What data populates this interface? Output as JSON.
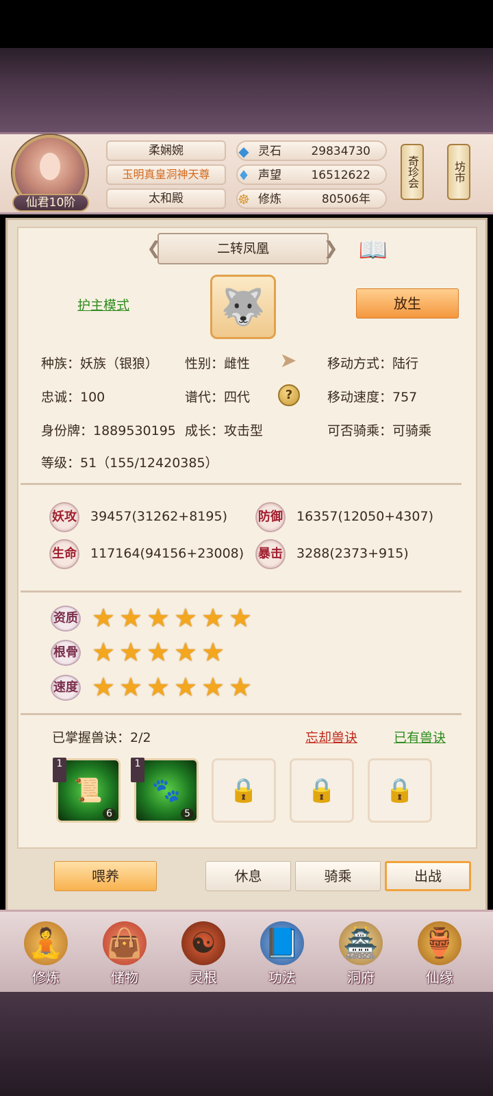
{
  "header": {
    "player_name": "柔娴婉",
    "title": "玉明真皇洞神天尊",
    "sect": "太和殿",
    "rank": "仙君10阶",
    "resources": [
      {
        "icon": "spirit-stone-icon",
        "label": "灵石",
        "value": "29834730"
      },
      {
        "icon": "reputation-icon",
        "label": "声望",
        "value": "16512622"
      },
      {
        "icon": "cultivation-icon",
        "label": "修炼",
        "value": "80506年"
      }
    ],
    "side_buttons": [
      "奇珍会",
      "坊市"
    ]
  },
  "pet": {
    "name": "二转凤凰",
    "mode_link": "护主模式",
    "release_label": "放生",
    "info": {
      "race": "种族：妖族（银狼）",
      "gender": "性别：雌性",
      "move_type": "移动方式：陆行",
      "loyalty": "忠诚：100",
      "generation": "谱代：四代",
      "move_speed": "移动速度：757",
      "id_tag": "身份牌：1889530195",
      "growth": "成长：攻击型",
      "rideable": "可否骑乘：可骑乘",
      "level": "等级：51（155/12420385）"
    },
    "stats": [
      {
        "label": "妖攻",
        "value": "39457(31262+8195)"
      },
      {
        "label": "防御",
        "value": "16357(12050+4307)"
      },
      {
        "label": "生命",
        "value": "117164(94156+23008)"
      },
      {
        "label": "暴击",
        "value": "3288(2373+915)"
      }
    ],
    "aptitudes": [
      {
        "label": "资质",
        "stars": 6
      },
      {
        "label": "根骨",
        "stars": 5
      },
      {
        "label": "速度",
        "stars": 6
      }
    ],
    "skills": {
      "mastered": "已掌握兽诀：2/2",
      "forget_link": "忘却兽诀",
      "owned_link": "已有兽诀",
      "slots": [
        {
          "level": "1",
          "count": "6"
        },
        {
          "level": "1",
          "count": "5"
        }
      ]
    }
  },
  "actions": {
    "feed": "喂养",
    "rest": "休息",
    "ride": "骑乘",
    "battle": "出战"
  },
  "nav": [
    {
      "label": "修炼",
      "icon": "cultivate-icon"
    },
    {
      "label": "储物",
      "icon": "storage-bag-icon"
    },
    {
      "label": "灵根",
      "icon": "spirit-root-icon"
    },
    {
      "label": "功法",
      "icon": "manual-book-icon"
    },
    {
      "label": "洞府",
      "icon": "cave-palace-icon"
    },
    {
      "label": "仙缘",
      "icon": "gourd-icon"
    }
  ],
  "colors": {
    "accent_orange": "#f4973e",
    "link_green": "#2e8b1e",
    "link_red": "#c0281c",
    "star": "#f3a61e"
  }
}
